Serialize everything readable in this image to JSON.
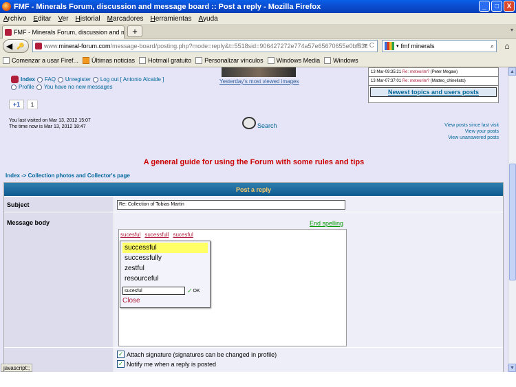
{
  "window": {
    "title": "FMF - Minerals Forum, discussion and message board :: Post a reply - Mozilla Firefox",
    "minimize": "_",
    "maximize": "□",
    "close": "X"
  },
  "menu": [
    "Archivo",
    "Editar",
    "Ver",
    "Historial",
    "Marcadores",
    "Herramientas",
    "Ayuda"
  ],
  "tab": {
    "label": "FMF - Minerals Forum, discussion and messa...",
    "new_tab": "+",
    "list_arrow": "▾"
  },
  "url": {
    "prefix": "www.",
    "host": "mineral-forum.com",
    "path": "/message-board/posting.php?mode=reply&t=5518sid=906427272e774a57e65670655e0bf53c"
  },
  "search": {
    "value": "fmf minerals"
  },
  "bookmarks": [
    "Comenzar a usar Firef...",
    "Últimas noticias",
    "Hotmail gratuito",
    "Personalizar vínculos",
    "Windows Media",
    "Windows"
  ],
  "header": {
    "index": "Index",
    "faq": "FAQ",
    "unregister": "Unregister",
    "logout": "Log out [ Antonio Alcaide ]",
    "profile": "Profile",
    "messages": "You have no new messages",
    "yesterday": "Yesterday's most viewed images",
    "gplus": "+1",
    "gplus_count": "1",
    "last_visit": "You last visited on Mar 13, 2012 15:07",
    "time_now": "The time now is Mar 13, 2012 18:47",
    "search_label": "Search",
    "view_since": "View posts since last visit",
    "view_yours": "View your posts",
    "view_unanswered": "View unanswered posts"
  },
  "recent": {
    "items": [
      {
        "time": "13 Mar-09:35:21",
        "title": "Re: meteorite?",
        "user": "(Peter Megaw)"
      },
      {
        "time": "13 Mar-07:37:01",
        "title": "Re: meteorite?",
        "user": "(Matteo_chinellato)"
      }
    ],
    "newest": "Newest topics and users posts"
  },
  "guide": "A general guide for using the Forum with some rules and tips",
  "breadcrumb": "Index -> Collection photos and Collector's page",
  "form": {
    "heading": "Post a reply",
    "subject_label": "Subject",
    "subject_value": "Re: Collection of Tobias Martin",
    "body_label": "Message body",
    "end_spelling": "End spelling",
    "misspelled": [
      "sucesful",
      "sucessfull",
      "sucesful"
    ],
    "suggestions": [
      "successful",
      "successfully",
      "zestful",
      "resourceful"
    ],
    "edit_value": "sucesful",
    "ok": "OK",
    "close": "Close",
    "attach_signature": "Attach signature (signatures can be changed in profile)",
    "notify": "Notify me when a reply is posted",
    "check_glyph": "✓"
  },
  "status": "javascript:;"
}
